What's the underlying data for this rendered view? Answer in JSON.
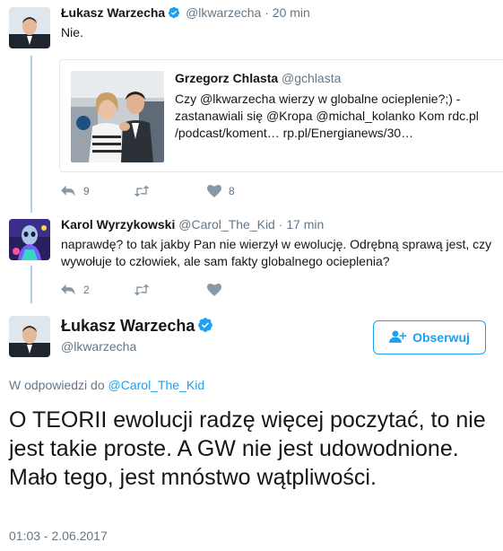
{
  "tweet1": {
    "name": "Łukasz Warzecha",
    "handle": "@lkwarzecha",
    "dot": "·",
    "time": "20 min",
    "text": "Nie.",
    "quote": {
      "name": "Grzegorz Chlasta",
      "handle": "@gchlasta",
      "text": "Czy @lkwarzecha wierzy w globalne ocieplenie?;) -zastanawiali się @Kropa @michal_kolanko Kom rdc.pl /podcast/koment… rp.pl/Energianews/30…"
    },
    "actions": {
      "reply_count": "9",
      "retweet_count": "",
      "like_count": "8"
    }
  },
  "tweet2": {
    "name": "Karol Wyrzykowski",
    "handle": "@Carol_The_Kid",
    "dot": "·",
    "time": "17 min",
    "text": "naprawdę? to tak jakby Pan nie wierzył w ewolucję. Odrębną sprawą jest, czy wywołuje to człowiek, ale sam fakty globalnego ocieplenia?",
    "actions": {
      "reply_count": "2",
      "retweet_count": "",
      "like_count": ""
    }
  },
  "main": {
    "name": "Łukasz Warzecha",
    "handle": "@lkwarzecha",
    "follow_label": "Obserwuj",
    "reply_prefix": "W odpowiedzi do",
    "reply_to": "@Carol_The_Kid",
    "text": "O TEORII ewolucji radzę więcej poczytać, to nie jest takie proste. A GW nie jest udowodnione. Mało tego, jest mnóstwo wątpliwości.",
    "date": "01:03 - 2.06.2017"
  },
  "colors": {
    "accent": "#1da1f2",
    "muted": "#657786",
    "thread": "#a8d3f0"
  },
  "icons": [
    "verified-icon",
    "reply-icon",
    "retweet-icon",
    "like-icon",
    "follow-icon"
  ]
}
